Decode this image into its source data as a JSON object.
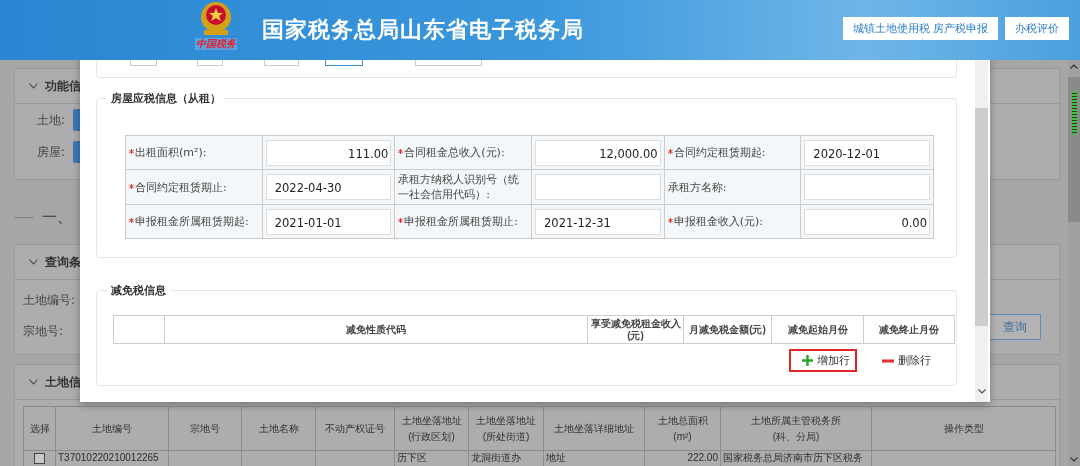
{
  "header": {
    "emblem_caption": "中国税务",
    "title": "国家税务总局山东省电子税务局",
    "buttons": [
      "城镇土地使用税 房产税申报",
      "办税评价"
    ]
  },
  "background": {
    "function_panel": {
      "title": "功能信",
      "items": [
        "土地:",
        "房屋:"
      ]
    },
    "section_heading": "一、",
    "query_panel": {
      "title": "查询条",
      "fields": [
        "土地编号:",
        "宗地号:"
      ],
      "button": "查询"
    },
    "land_panel": {
      "title": "土地信",
      "select_column": "选择",
      "columns": [
        "土地编号",
        "宗地号",
        "土地名称",
        "不动产权证号",
        "土地坐落地址\n(行政区划)",
        "土地坐落地址\n(所处街道)",
        "土地坐落详细地址",
        "土地总面积\n(m²)",
        "土地所属主管税务所\n(科、分局)",
        "操作类型"
      ],
      "rows": [
        {
          "selected": false,
          "cells": [
            "T37010220210012265",
            "",
            "",
            "",
            "历下区",
            "龙洞街道办",
            "地址",
            "222.00",
            "国家税务总局济南市历下区税务"
          ]
        }
      ]
    }
  },
  "dialog": {
    "rental_section": {
      "title": "房屋应税信息（从租）",
      "rows": [
        [
          {
            "label": "出租面积(m²):",
            "required": true,
            "kind": "number",
            "value": "111.00"
          },
          {
            "label": "合同租金总收入(元):",
            "required": true,
            "kind": "number",
            "value": "12,000.00"
          },
          {
            "label": "合同约定租赁期起:",
            "required": true,
            "kind": "date",
            "value": "2020-12-01"
          }
        ],
        [
          {
            "label": "合同约定租赁期止:",
            "required": true,
            "kind": "date",
            "value": "2022-04-30"
          },
          {
            "label": "承租方纳税人识别号（统一社会信用代码）:",
            "required": false,
            "kind": "text"
          },
          {
            "label": "承租方名称:",
            "required": false,
            "kind": "text"
          }
        ],
        [
          {
            "label": "申报租金所属租赁期起:",
            "required": true,
            "kind": "date",
            "value": "2021-01-01"
          },
          {
            "label": "申报租金所属租赁期止:",
            "required": true,
            "kind": "date",
            "value": "2021-12-31"
          },
          {
            "label": "申报租金收入(元):",
            "required": true,
            "kind": "number",
            "value": "0.00"
          }
        ]
      ]
    },
    "exemption_section": {
      "title": "减免税信息",
      "columns": [
        "减免性质代码",
        "享受减免税租金收入(元)",
        "月减免税金额(元)",
        "减免起始月份",
        "减免终止月份"
      ],
      "actions": [
        {
          "label": "增加行",
          "kind": "add",
          "highlighted": true
        },
        {
          "label": "删除行",
          "kind": "remove",
          "highlighted": false
        }
      ]
    }
  }
}
